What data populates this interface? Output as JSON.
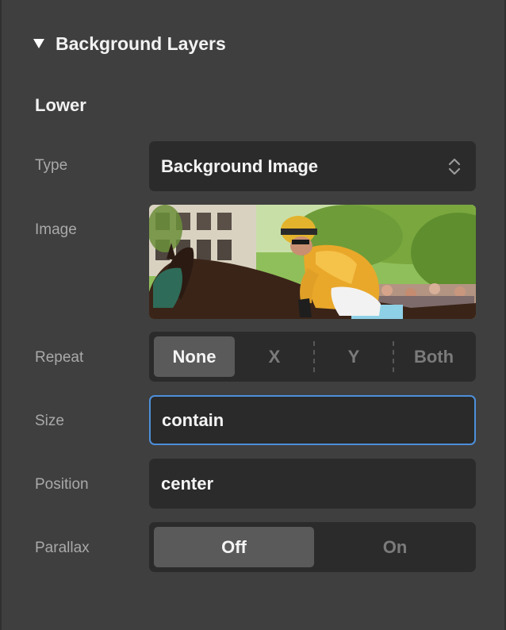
{
  "section": {
    "title": "Background Layers"
  },
  "layer": {
    "title": "Lower"
  },
  "fields": {
    "type": {
      "label": "Type",
      "value": "Background Image"
    },
    "image": {
      "label": "Image"
    },
    "repeat": {
      "label": "Repeat",
      "options": [
        "None",
        "X",
        "Y",
        "Both"
      ],
      "selected": "None"
    },
    "size": {
      "label": "Size",
      "value": "contain"
    },
    "position": {
      "label": "Position",
      "value": "center"
    },
    "parallax": {
      "label": "Parallax",
      "options": [
        "Off",
        "On"
      ],
      "selected": "Off"
    }
  },
  "colors": {
    "panel_bg": "#3f3f3f",
    "control_bg": "#2b2b2b",
    "active_segment": "#5a5a5a",
    "focus_ring": "#4d8fdb"
  }
}
